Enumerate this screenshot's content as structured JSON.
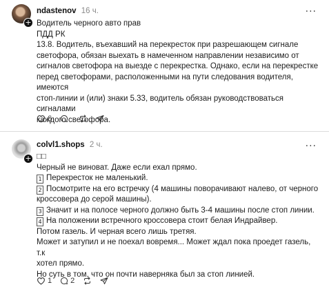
{
  "post1": {
    "username": "ndastenov",
    "time": "16 ч.",
    "more": "···",
    "lines": [
      "Водитель черного авто прав",
      "ПДД РК",
      "13.8. Водитель, въехавший на перекресток при разрешающем сигнале",
      "светофора, обязан выехать в намеченном направлении независимо от",
      "сигналов светофора на выезде с перекрестка. Однако, если на перекрестке",
      "перед светофорами, расположенными на пути следования водителя, имеются",
      "стоп-линии и (или) знаки 5.33, водитель обязан руководствоваться сигналами",
      "каждого светофора."
    ],
    "likes": "6",
    "replies": "",
    "reposts": "",
    "shares": ""
  },
  "post2": {
    "username": "colvl1.shops",
    "time": "2 ч.",
    "more": "···",
    "emoji": "□□",
    "lines": [
      "Черный не виноват. Даже если ехал прямо."
    ],
    "numbered": [
      {
        "num": "1",
        "text": "Перекресток не маленький."
      },
      {
        "num": "2",
        "text": "Посмотрите на его встречку (4 машины поворачивают налево, от черного"
      },
      {
        "num": "",
        "text": "кроссовера до серой машины)."
      },
      {
        "num": "3",
        "text": "Значит и на полосе черного должно быть 3-4 машины после стоп линии."
      },
      {
        "num": "4",
        "text": "На положении встречного кроссовера стоит белая Индрайвер."
      }
    ],
    "tail": [
      "Потом газель. И черная всего лишь третяя.",
      "Может и затупил и не поехал вовремя... Может ждал пока проедет газель, т.к",
      "хотел прямо.",
      "Но суть в том, что он почти наверняка был за стоп линией."
    ],
    "likes": "1",
    "replies": "2",
    "reposts": "",
    "shares": ""
  }
}
